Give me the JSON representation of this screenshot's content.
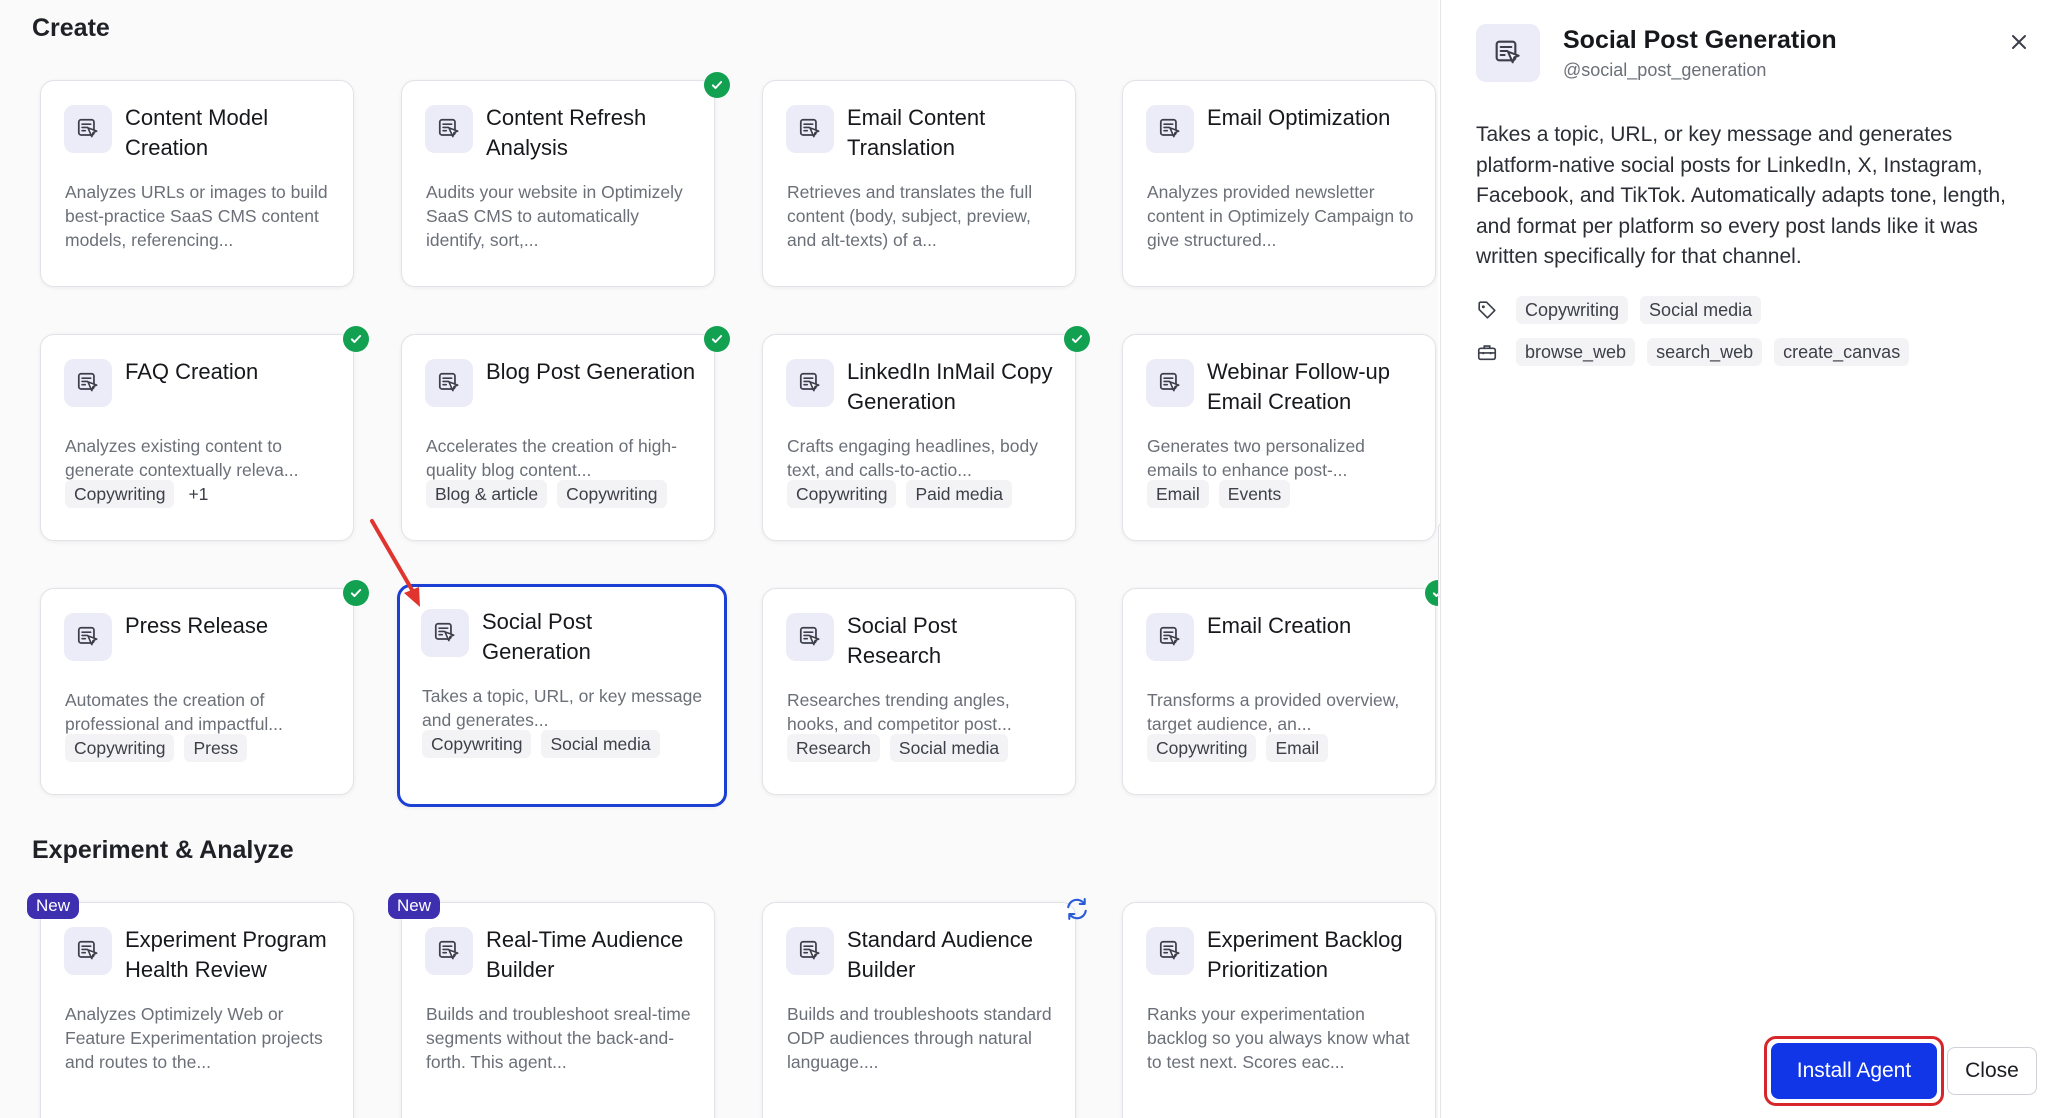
{
  "sections": {
    "create": "Create",
    "experiment": "Experiment & Analyze"
  },
  "cards": {
    "content_model": {
      "title": "Content Model Creation",
      "desc": "Analyzes URLs or images to build best-practice SaaS CMS content models, referencing...",
      "tags": [],
      "installed": false
    },
    "content_refresh": {
      "title": "Content Refresh Analysis",
      "desc": "Audits your website in Optimizely SaaS CMS to automatically identify, sort,...",
      "tags": [],
      "installed": true
    },
    "email_translation": {
      "title": "Email Content Translation",
      "desc": "Retrieves and translates the full content (body, subject, preview, and alt-texts) of a...",
      "tags": [],
      "installed": false
    },
    "email_optimization": {
      "title": "Email Optimization",
      "desc": "Analyzes provided newsletter content in Optimizely Campaign to give structured...",
      "tags": [],
      "installed": false
    },
    "faq": {
      "title": "FAQ Creation",
      "desc": "Analyzes existing content to generate contextually releva...",
      "tags": [
        "Copywriting",
        "+1"
      ],
      "installed": true
    },
    "blog_post": {
      "title": "Blog Post Generation",
      "desc": "Accelerates the creation of high-quality blog content...",
      "tags": [
        "Blog & article",
        "Copywriting"
      ],
      "installed": true
    },
    "linkedin": {
      "title": "LinkedIn InMail Copy Generation",
      "desc": "Crafts engaging headlines, body text, and calls-to-actio...",
      "tags": [
        "Copywriting",
        "Paid media"
      ],
      "installed": true
    },
    "webinar": {
      "title": "Webinar Follow-up Email Creation",
      "desc": "Generates two personalized emails to enhance post-...",
      "tags": [
        "Email",
        "Events"
      ],
      "installed": false
    },
    "press_release": {
      "title": "Press Release",
      "desc": "Automates the creation of professional and impactful...",
      "tags": [
        "Copywriting",
        "Press"
      ],
      "installed": true
    },
    "social_post_gen": {
      "title": "Social Post Generation",
      "desc": "Takes a topic, URL, or key message and generates...",
      "tags": [
        "Copywriting",
        "Social media"
      ],
      "installed": false
    },
    "social_post_research": {
      "title": "Social Post Research",
      "desc": "Researches trending angles, hooks, and competitor post...",
      "tags": [
        "Research",
        "Social media"
      ],
      "installed": false
    },
    "email_creation": {
      "title": "Email Creation",
      "desc": "Transforms a provided overview, target audience, an...",
      "tags": [
        "Copywriting",
        "Email"
      ],
      "installed": true
    },
    "exp_health": {
      "title": "Experiment Program Health Review",
      "desc": "Analyzes Optimizely Web or Feature Experimentation projects and routes to the...",
      "badge": "New"
    },
    "realtime_audience": {
      "title": "Real-Time Audience Builder",
      "desc": "Builds and troubleshoot sreal-time segments without the back-and-forth. This agent...",
      "badge": "New"
    },
    "standard_audience": {
      "title": "Standard Audience Builder",
      "desc": "Builds and troubleshoots standard ODP audiences through natural language...."
    },
    "exp_backlog": {
      "title": "Experiment Backlog Prioritization",
      "desc": "Ranks your experimentation backlog so you always know what to test next. Scores eac..."
    }
  },
  "panel": {
    "title": "Social Post Generation",
    "handle": "@social_post_generation",
    "description": "Takes a topic, URL, or key message and generates platform-native social posts for LinkedIn, X, Instagram, Facebook, and TikTok. Automatically adapts tone, length, and format per platform so every post lands like it was written specifically for that channel.",
    "categories": [
      "Copywriting",
      "Social media"
    ],
    "tools": [
      "browse_web",
      "search_web",
      "create_canvas"
    ],
    "install_label": "Install Agent",
    "close_label": "Close"
  },
  "colors": {
    "accent": "#1136e8",
    "selected_border": "#1c3fd4",
    "installed_green": "#12a150",
    "new_badge": "#3d2fb0",
    "highlight_red": "#d7262b",
    "icon_bg": "#ecebf8"
  },
  "icons": {
    "agent": "agent-cursor-icon",
    "installed": "check-circle-icon",
    "update": "sync-icon",
    "close": "close-icon",
    "categories": "tag-icon",
    "tools": "toolbox-icon"
  }
}
